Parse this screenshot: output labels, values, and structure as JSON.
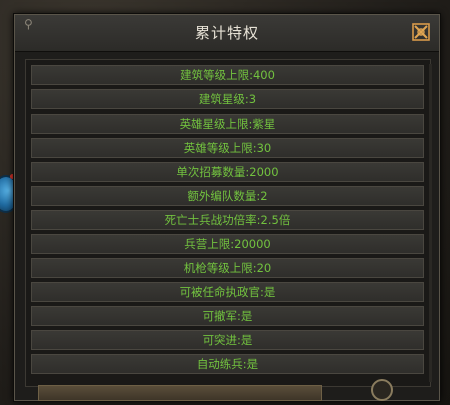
{
  "dialog": {
    "title": "累计特权"
  },
  "privileges": [
    "建筑等级上限:400",
    "建筑星级:3",
    "英雄星级上限:紫星",
    "英雄等级上限:30",
    "单次招募数量:2000",
    "额外编队数量:2",
    "死亡士兵战功倍率:2.5倍",
    "兵营上限:20000",
    "机枪等级上限:20",
    "可被任命执政官:是",
    "可撤军:是",
    "可突进:是",
    "自动练兵:是"
  ],
  "colors": {
    "privilege_text": "#72c23f",
    "title_text": "#e7e2d6",
    "close_icon": "#d89a4a"
  },
  "icons": {
    "close": "close-icon",
    "pin": "pin-icon"
  }
}
